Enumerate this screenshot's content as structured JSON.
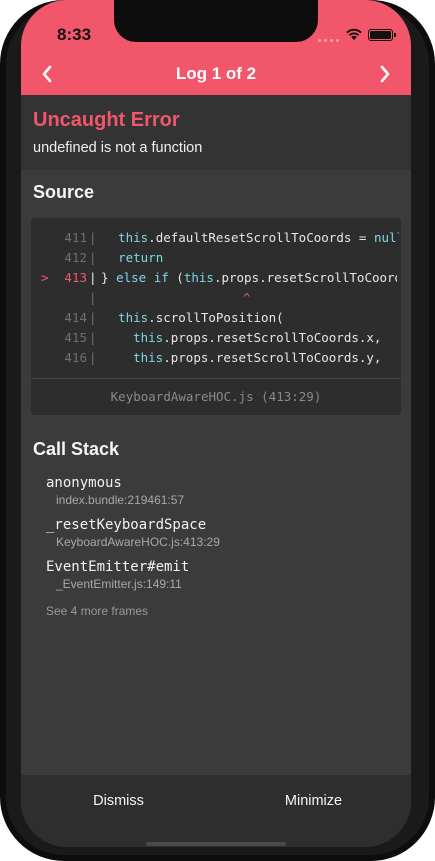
{
  "status_bar": {
    "time": "8:33"
  },
  "nav": {
    "title": "Log 1 of 2"
  },
  "error": {
    "title": "Uncaught Error",
    "message": "undefined is not a function"
  },
  "source": {
    "title": "Source",
    "lines": [
      {
        "number": "411",
        "code": "  this.defaultResetScrollToCoords = null",
        "active": false
      },
      {
        "number": "412",
        "code": "  return",
        "active": false
      },
      {
        "number": "413",
        "code": "} else if (this.props.resetScrollToCoords",
        "active": true,
        "marker": ">"
      },
      {
        "number": "",
        "code": "",
        "active": false,
        "caret": "^"
      },
      {
        "number": "414",
        "code": "  this.scrollToPosition(",
        "active": false
      },
      {
        "number": "415",
        "code": "    this.props.resetScrollToCoords.x,",
        "active": false
      },
      {
        "number": "416",
        "code": "    this.props.resetScrollToCoords.y,",
        "active": false
      }
    ],
    "file": "KeyboardAwareHOC.js (413:29)"
  },
  "call_stack": {
    "title": "Call Stack",
    "frames": [
      {
        "name": "anonymous",
        "location": "index.bundle:219461:57"
      },
      {
        "name": "_resetKeyboardSpace",
        "location": "KeyboardAwareHOC.js:413:29"
      },
      {
        "name": "EventEmitter#emit",
        "location": "_EventEmitter.js:149:11"
      }
    ],
    "see_more": "See 4 more frames"
  },
  "footer": {
    "dismiss": "Dismiss",
    "minimize": "Minimize"
  },
  "colors": {
    "accent": "#f2566b",
    "background": "#3b3b3b",
    "code_keyword": "#7fd6e6"
  },
  "icons": {
    "prev": "chevron-left-icon",
    "next": "chevron-right-icon",
    "signal": "signal-icon",
    "wifi": "wifi-icon",
    "battery": "battery-icon"
  }
}
